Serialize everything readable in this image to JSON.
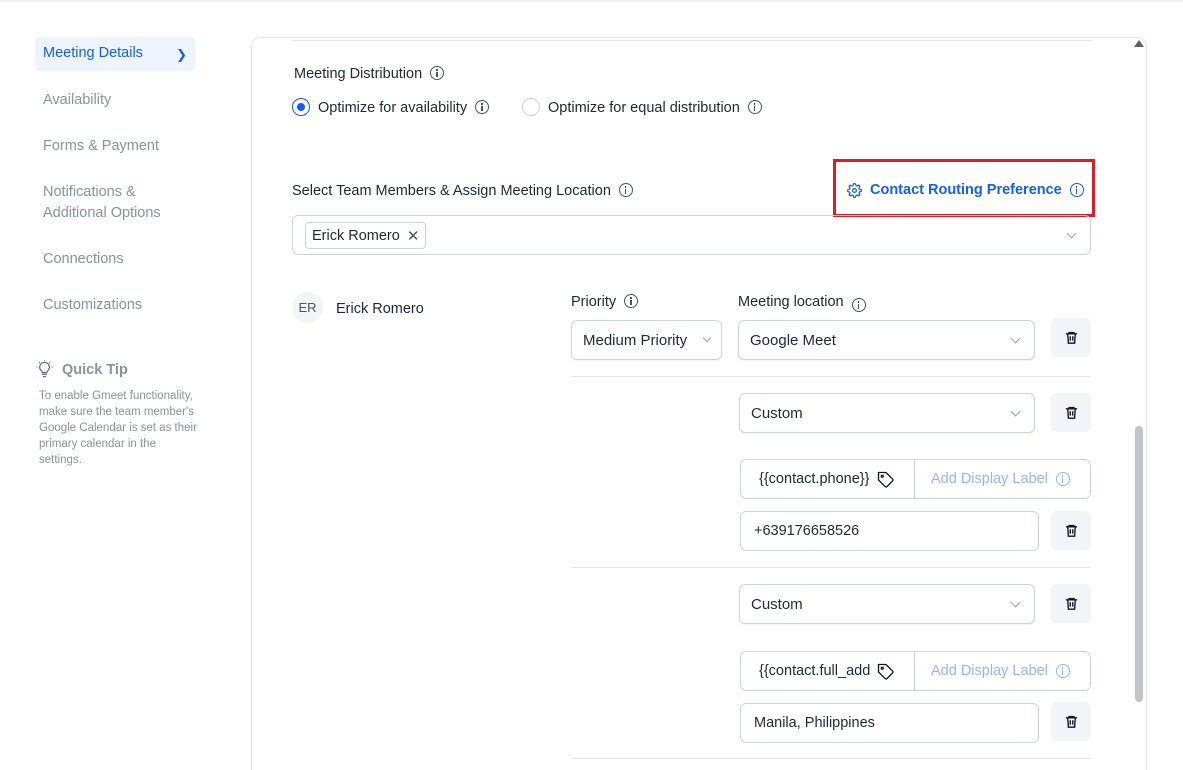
{
  "sidebar": {
    "items": [
      {
        "label": "Meeting Details",
        "active": true
      },
      {
        "label": "Availability"
      },
      {
        "label": "Forms & Payment"
      },
      {
        "label": "Notifications & Additional Options"
      },
      {
        "label": "Connections"
      },
      {
        "label": "Customizations"
      }
    ],
    "quick_tip": {
      "title": "Quick Tip",
      "body": "To enable Gmeet functionality, make sure the team member's Google Calendar is set as their primary calendar in the settings."
    }
  },
  "distribution": {
    "label": "Meeting Distribution",
    "options": [
      {
        "label": "Optimize for availability",
        "selected": true
      },
      {
        "label": "Optimize for equal distribution",
        "selected": false
      }
    ]
  },
  "team": {
    "label": "Select Team Members & Assign Meeting Location",
    "routing_link": "Contact Routing Preference",
    "selected_chip": "Erick Romero"
  },
  "member": {
    "initials": "ER",
    "name": "Erick Romero",
    "priority_label": "Priority",
    "location_label": "Meeting location",
    "priority_value": "Medium Priority",
    "locations": [
      {
        "type": "Google Meet"
      },
      {
        "type": "Custom",
        "variable": "{{contact.phone}}",
        "display_label_placeholder": "Add Display Label",
        "value": "+639176658526"
      },
      {
        "type": "Custom",
        "variable": "{{contact.full_add",
        "display_label_placeholder": "Add Display Label",
        "value": "Manila, Philippines"
      }
    ]
  },
  "colors": {
    "accent": "#155eef",
    "highlight_box": "#d9202a"
  }
}
